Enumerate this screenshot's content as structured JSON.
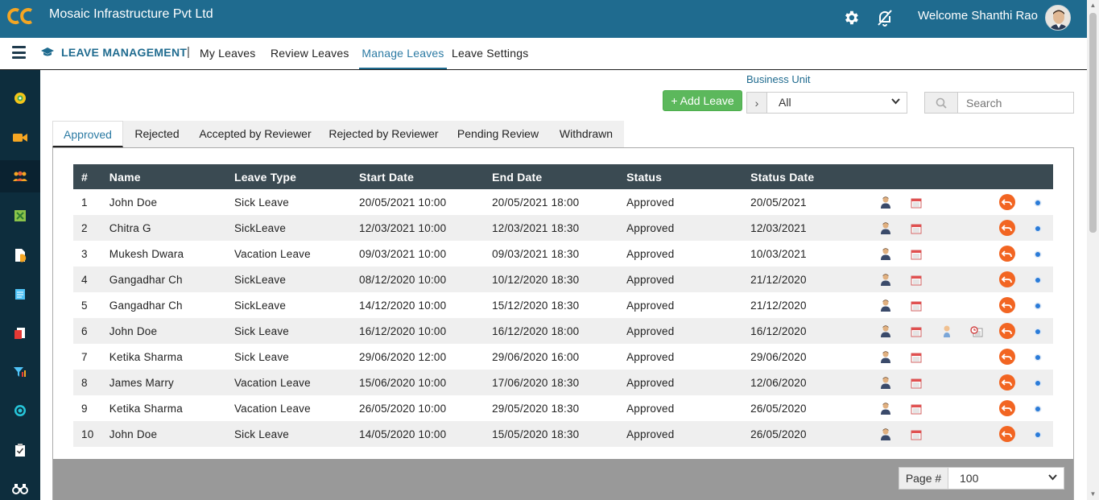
{
  "header": {
    "company": "Mosaic Infrastructure Pvt Ltd",
    "welcome": "Welcome Shanthi Rao",
    "icons": [
      "settings-gear-icon",
      "notifications-off-icon"
    ],
    "brand_color": "#1f6b8f"
  },
  "subnav": {
    "module_title": "LEAVE MANAGEMENT",
    "separator": "|",
    "items": [
      {
        "label": "My Leaves",
        "active": false
      },
      {
        "label": "Review Leaves",
        "active": false
      },
      {
        "label": "Manage Leaves",
        "active": true
      },
      {
        "label": "Leave Settings",
        "active": false
      }
    ]
  },
  "sidebar": {
    "icons": [
      "dashboard-icon",
      "video-icon",
      "team-icon",
      "spreadsheet-icon",
      "document-icon",
      "notes-icon",
      "report-icon",
      "filter-icon",
      "target-icon",
      "checklist-icon",
      "binoculars-icon"
    ],
    "active_index": 2
  },
  "controls": {
    "add_button": "+ Add Leave",
    "business_unit_label": "Business Unit",
    "business_unit_value": "All",
    "search_placeholder": "Search"
  },
  "tabs": [
    {
      "label": "Approved",
      "active": true
    },
    {
      "label": "Rejected",
      "active": false
    },
    {
      "label": "Accepted by Reviewer",
      "active": false
    },
    {
      "label": "Rejected by Reviewer",
      "active": false
    },
    {
      "label": "Pending Review",
      "active": false
    },
    {
      "label": "Withdrawn",
      "active": false
    }
  ],
  "table": {
    "columns": [
      "#",
      "Name",
      "Leave Type",
      "Start Date",
      "End Date",
      "Status",
      "Status Date"
    ],
    "rows": [
      {
        "no": "1",
        "name": "John Doe",
        "type": "Sick Leave",
        "start": "20/05/2021 10:00",
        "end": "20/05/2021 18:00",
        "status": "Approved",
        "status_date": "20/05/2021",
        "extra_icons": false
      },
      {
        "no": "2",
        "name": "Chitra G",
        "type": "SickLeave",
        "start": "12/03/2021 10:00",
        "end": "12/03/2021 18:30",
        "status": "Approved",
        "status_date": "12/03/2021",
        "extra_icons": false
      },
      {
        "no": "3",
        "name": "Mukesh Dwara",
        "type": "Vacation Leave",
        "start": "09/03/2021 10:00",
        "end": "09/03/2021 18:30",
        "status": "Approved",
        "status_date": "10/03/2021",
        "extra_icons": false
      },
      {
        "no": "4",
        "name": "Gangadhar Ch",
        "type": "SickLeave",
        "start": "08/12/2020 10:00",
        "end": "10/12/2020 18:30",
        "status": "Approved",
        "status_date": "21/12/2020",
        "extra_icons": false
      },
      {
        "no": "5",
        "name": "Gangadhar Ch",
        "type": "SickLeave",
        "start": "14/12/2020 10:00",
        "end": "15/12/2020 18:30",
        "status": "Approved",
        "status_date": "21/12/2020",
        "extra_icons": false
      },
      {
        "no": "6",
        "name": "John Doe",
        "type": "Sick Leave",
        "start": "16/12/2020 10:00",
        "end": "16/12/2020 18:00",
        "status": "Approved",
        "status_date": "16/12/2020",
        "extra_icons": true
      },
      {
        "no": "7",
        "name": "Ketika Sharma",
        "type": "Sick Leave",
        "start": "29/06/2020 12:00",
        "end": "29/06/2020 16:00",
        "status": "Approved",
        "status_date": "29/06/2020",
        "extra_icons": false
      },
      {
        "no": "8",
        "name": "James Marry",
        "type": "Vacation Leave",
        "start": "15/06/2020 10:00",
        "end": "17/06/2020 18:30",
        "status": "Approved",
        "status_date": "12/06/2020",
        "extra_icons": false
      },
      {
        "no": "9",
        "name": "Ketika Sharma",
        "type": "Vacation Leave",
        "start": "26/05/2020 10:00",
        "end": "29/05/2020 18:30",
        "status": "Approved",
        "status_date": "26/05/2020",
        "extra_icons": false
      },
      {
        "no": "10",
        "name": "John Doe",
        "type": "Sick Leave",
        "start": "14/05/2020 10:00",
        "end": "15/05/2020 18:30",
        "status": "Approved",
        "status_date": "26/05/2020",
        "extra_icons": false
      }
    ],
    "row_icons": [
      "user-icon",
      "calendar-icon",
      "reviewer-icon",
      "calendar-clock-icon",
      "undo-icon",
      "info-dot-icon"
    ]
  },
  "pagination": {
    "label": "Page #",
    "value": "100"
  }
}
